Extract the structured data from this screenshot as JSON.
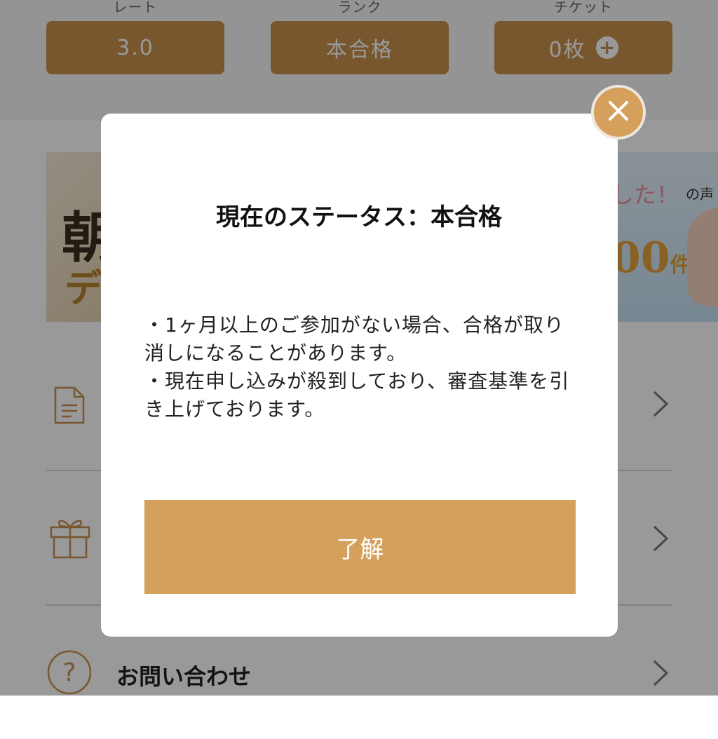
{
  "stats": [
    {
      "label": "レート",
      "value": "3.0"
    },
    {
      "label": "ランク",
      "value": "本合格"
    },
    {
      "label": "チケット",
      "value": "0枚"
    }
  ],
  "banners": {
    "left": {
      "char1": "朝",
      "char2": "デ"
    },
    "right": {
      "text1": "した！",
      "text2": "の声",
      "text3": "00",
      "text4": "件"
    }
  },
  "menu": {
    "contact_label": "お問い合わせ"
  },
  "modal": {
    "title": "現在のステータス：本合格",
    "body_lines": [
      "・1ヶ月以上のご参加がない場合、合格が取り消しになることがあります。",
      "・現在申し込みが殺到しており、審査基準を引き上げております。"
    ],
    "ok_label": "了解"
  },
  "colors": {
    "accent": "#d4a05c",
    "stat_box": "#c8914f",
    "overlay": "rgba(0,0,0,0.40)"
  },
  "icons": [
    "plus-icon",
    "document-icon",
    "gift-icon",
    "question-icon",
    "chevron-right-icon",
    "close-icon"
  ]
}
